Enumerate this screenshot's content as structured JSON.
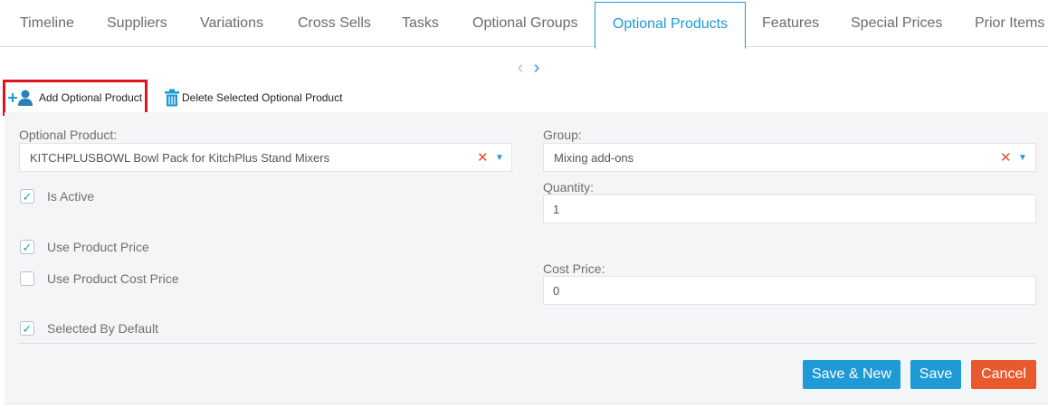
{
  "tabs": [
    {
      "label": "Timeline"
    },
    {
      "label": "Suppliers"
    },
    {
      "label": "Variations"
    },
    {
      "label": "Cross Sells"
    },
    {
      "label": "Tasks"
    },
    {
      "label": "Optional Groups"
    },
    {
      "label": "Optional Products"
    },
    {
      "label": "Features"
    },
    {
      "label": "Special Prices"
    },
    {
      "label": "Prior Items"
    }
  ],
  "active_tab": "Optional Products",
  "pager": {
    "prev": "‹",
    "next": "›"
  },
  "toolbar": {
    "add_label": "Add Optional Product",
    "delete_label": "Delete Selected Optional Product",
    "add_icon": "add-user-icon",
    "delete_icon": "trash-icon"
  },
  "form": {
    "optional_product_label": "Optional Product:",
    "optional_product_value": "KITCHPLUSBOWL Bowl Pack for KitchPlus Stand Mixers",
    "group_label": "Group:",
    "group_value": "Mixing add-ons",
    "quantity_label": "Quantity:",
    "quantity_value": "1",
    "cost_price_label": "Cost Price:",
    "cost_price_value": "0",
    "is_active_label": "Is Active",
    "is_active_checked": true,
    "use_product_price_label": "Use Product Price",
    "use_product_price_checked": true,
    "use_product_cost_price_label": "Use Product Cost Price",
    "use_product_cost_price_checked": false,
    "selected_by_default_label": "Selected By Default",
    "selected_by_default_checked": true
  },
  "actions": {
    "save_new_label": "Save & New",
    "save_label": "Save",
    "cancel_label": "Cancel"
  },
  "colors": {
    "accent": "#1e9ad6",
    "cancel": "#e85a2e",
    "highlight_border": "#e0141d",
    "clear_icon": "#e4502a"
  }
}
